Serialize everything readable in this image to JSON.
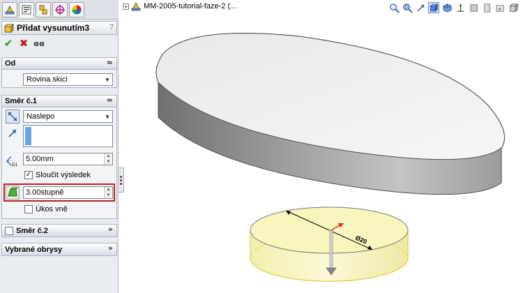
{
  "property_manager": {
    "title": "Přidat vysunutím3",
    "help_glyph": "?",
    "tabs": [
      "feature-manager-icon",
      "property-manager-icon",
      "configuration-manager-icon",
      "dimxpert-icon",
      "display-manager-icon"
    ],
    "actions": {
      "ok": "✔",
      "cancel": "✖",
      "preview": "ɞɞ"
    },
    "groups": {
      "from": {
        "label": "Od",
        "collapse_glyph": "≈",
        "value": "Rovina skici"
      },
      "direction1": {
        "label": "Směr č.1",
        "collapse_glyph": "≈",
        "end_condition": "Naslepo",
        "depth": "5.00mm",
        "merge_label": "Sloučit výsledek",
        "merge_checked": true,
        "draft_angle": "3.00stupně",
        "draft_outward_label": "Úkos vně",
        "draft_outward_checked": false,
        "depth_icon_label": "D1"
      },
      "direction2": {
        "label": "Směr č.2",
        "collapse_glyph": "»",
        "checked": false
      },
      "selected_contours": {
        "label": "Vybrané obrysy",
        "collapse_glyph": "»"
      }
    }
  },
  "viewport": {
    "tree_label": "MM-2005-tutorial-faze-2  (...",
    "tree_expand": "+",
    "dimension_label": "Ø20",
    "hud_icons": [
      "zoom-to-fit-icon",
      "zoom-to-area-icon",
      "previous-view-icon",
      "section-view-icon",
      "view-orientation-icon",
      "display-style-icon",
      "hide-show-icon",
      "edit-appearance-icon",
      "apply-scene-icon",
      "view-settings-icon"
    ],
    "colors": {
      "body_top": "#f0f0f0",
      "body_side": "#8c8c8c",
      "preview_fill": "#f7f4b8",
      "preview_edge": "#d6cc32",
      "arrow_red": "#e0221e"
    }
  }
}
